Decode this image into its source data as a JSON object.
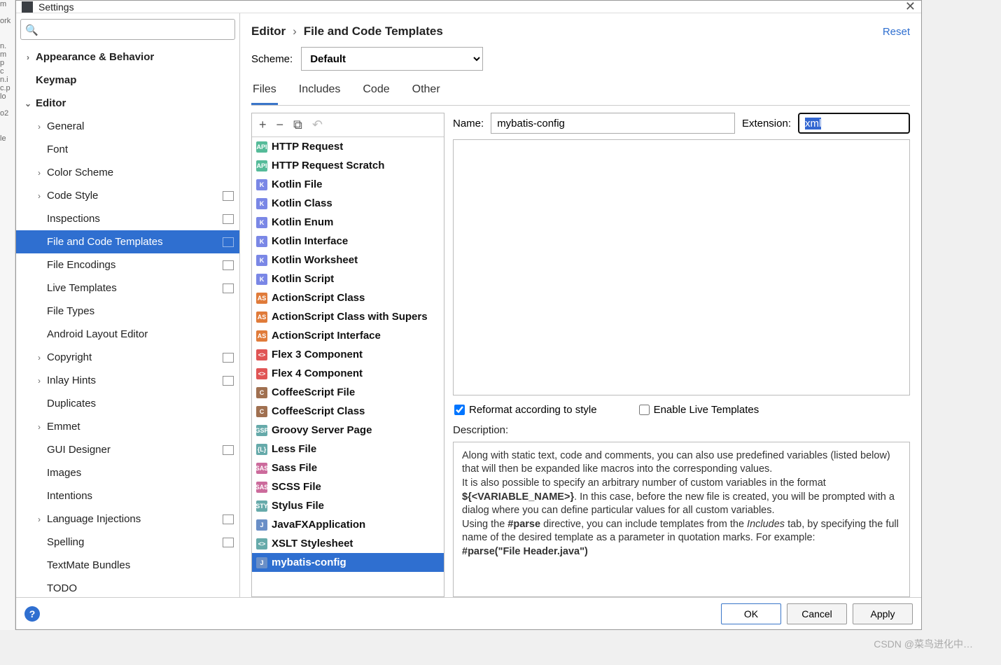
{
  "window": {
    "title": "Settings"
  },
  "search": {
    "placeholder": ""
  },
  "reset_label": "Reset",
  "breadcrumb": {
    "root": "Editor",
    "page": "File and Code Templates"
  },
  "scheme": {
    "label": "Scheme:",
    "value": "Default"
  },
  "tabs": [
    "Files",
    "Includes",
    "Code",
    "Other"
  ],
  "sidebar": [
    {
      "label": "Appearance & Behavior",
      "depth": 0,
      "bold": true,
      "arrow": ">"
    },
    {
      "label": "Keymap",
      "depth": 0,
      "bold": true,
      "arrow": ""
    },
    {
      "label": "Editor",
      "depth": 0,
      "bold": true,
      "arrow": "v"
    },
    {
      "label": "General",
      "depth": 1,
      "bold": false,
      "arrow": ">"
    },
    {
      "label": "Font",
      "depth": 1,
      "bold": false,
      "arrow": ""
    },
    {
      "label": "Color Scheme",
      "depth": 1,
      "bold": false,
      "arrow": ">"
    },
    {
      "label": "Code Style",
      "depth": 1,
      "bold": false,
      "arrow": ">",
      "badge": true
    },
    {
      "label": "Inspections",
      "depth": 1,
      "bold": false,
      "arrow": "",
      "badge": true
    },
    {
      "label": "File and Code Templates",
      "depth": 1,
      "bold": false,
      "arrow": "",
      "badge": true,
      "selected": true
    },
    {
      "label": "File Encodings",
      "depth": 1,
      "bold": false,
      "arrow": "",
      "badge": true
    },
    {
      "label": "Live Templates",
      "depth": 1,
      "bold": false,
      "arrow": "",
      "badge": true
    },
    {
      "label": "File Types",
      "depth": 1,
      "bold": false,
      "arrow": ""
    },
    {
      "label": "Android Layout Editor",
      "depth": 1,
      "bold": false,
      "arrow": ""
    },
    {
      "label": "Copyright",
      "depth": 1,
      "bold": false,
      "arrow": ">",
      "badge": true
    },
    {
      "label": "Inlay Hints",
      "depth": 1,
      "bold": false,
      "arrow": ">",
      "badge": true
    },
    {
      "label": "Duplicates",
      "depth": 1,
      "bold": false,
      "arrow": ""
    },
    {
      "label": "Emmet",
      "depth": 1,
      "bold": false,
      "arrow": ">"
    },
    {
      "label": "GUI Designer",
      "depth": 1,
      "bold": false,
      "arrow": "",
      "badge": true
    },
    {
      "label": "Images",
      "depth": 1,
      "bold": false,
      "arrow": ""
    },
    {
      "label": "Intentions",
      "depth": 1,
      "bold": false,
      "arrow": ""
    },
    {
      "label": "Language Injections",
      "depth": 1,
      "bold": false,
      "arrow": ">",
      "badge": true
    },
    {
      "label": "Spelling",
      "depth": 1,
      "bold": false,
      "arrow": "",
      "badge": true
    },
    {
      "label": "TextMate Bundles",
      "depth": 1,
      "bold": false,
      "arrow": ""
    },
    {
      "label": "TODO",
      "depth": 1,
      "bold": false,
      "arrow": ""
    }
  ],
  "templates": [
    {
      "label": "HTTP Request",
      "tag": "API",
      "c": "#5b9"
    },
    {
      "label": "HTTP Request Scratch",
      "tag": "API",
      "c": "#5b9"
    },
    {
      "label": "Kotlin File",
      "tag": "K",
      "c": "#7a87e6"
    },
    {
      "label": "Kotlin Class",
      "tag": "K",
      "c": "#7a87e6"
    },
    {
      "label": "Kotlin Enum",
      "tag": "K",
      "c": "#7a87e6"
    },
    {
      "label": "Kotlin Interface",
      "tag": "K",
      "c": "#7a87e6"
    },
    {
      "label": "Kotlin Worksheet",
      "tag": "K",
      "c": "#7a87e6"
    },
    {
      "label": "Kotlin Script",
      "tag": "K",
      "c": "#7a87e6"
    },
    {
      "label": "ActionScript Class",
      "tag": "AS",
      "c": "#e07b3a"
    },
    {
      "label": "ActionScript Class with Supers",
      "tag": "AS",
      "c": "#e07b3a"
    },
    {
      "label": "ActionScript Interface",
      "tag": "AS",
      "c": "#e07b3a"
    },
    {
      "label": "Flex 3 Component",
      "tag": "<>",
      "c": "#e05555"
    },
    {
      "label": "Flex 4 Component",
      "tag": "<>",
      "c": "#e05555"
    },
    {
      "label": "CoffeeScript File",
      "tag": "C",
      "c": "#a07050"
    },
    {
      "label": "CoffeeScript Class",
      "tag": "C",
      "c": "#a07050"
    },
    {
      "label": "Groovy Server Page",
      "tag": "GSP",
      "c": "#6aa"
    },
    {
      "label": "Less File",
      "tag": "{L}",
      "c": "#6aa"
    },
    {
      "label": "Sass File",
      "tag": "SASS",
      "c": "#cc6b9c"
    },
    {
      "label": "SCSS File",
      "tag": "SASS",
      "c": "#cc6b9c"
    },
    {
      "label": "Stylus File",
      "tag": "STYL",
      "c": "#6aa"
    },
    {
      "label": "JavaFXApplication",
      "tag": "J",
      "c": "#6a8fc7"
    },
    {
      "label": "XSLT Stylesheet",
      "tag": "<>",
      "c": "#6aa"
    },
    {
      "label": "mybatis-config",
      "tag": "J",
      "c": "#6a8fc7",
      "selected": true
    }
  ],
  "form": {
    "name_label": "Name:",
    "name_value": "mybatis-config",
    "ext_label": "Extension:",
    "ext_value": "xml"
  },
  "options": {
    "reformat": "Reformat according to style",
    "reformat_checked": true,
    "enable_live": "Enable Live Templates",
    "enable_live_checked": false
  },
  "description": {
    "label": "Description:",
    "p1": "Along with static text, code and comments, you can also use predefined variables (listed below) that will then be expanded like macros into the corresponding values.",
    "p2_a": "It is also possible to specify an arbitrary number of custom variables in the format ",
    "p2_b": "${<VARIABLE_NAME>}",
    "p2_c": ". In this case, before the new file is created, you will be prompted with a dialog where you can define particular values for all custom variables.",
    "p3_a": "Using the ",
    "p3_b": "#parse",
    "p3_c": " directive, you can include templates from the ",
    "p3_d": "Includes",
    "p3_e": " tab, by specifying the full name of the desired template as a parameter in quotation marks. For example:",
    "p4": "#parse(\"File Header.java\")"
  },
  "buttons": {
    "ok": "OK",
    "cancel": "Cancel",
    "apply": "Apply"
  },
  "watermark": "CSDN @菜鸟进化中…"
}
